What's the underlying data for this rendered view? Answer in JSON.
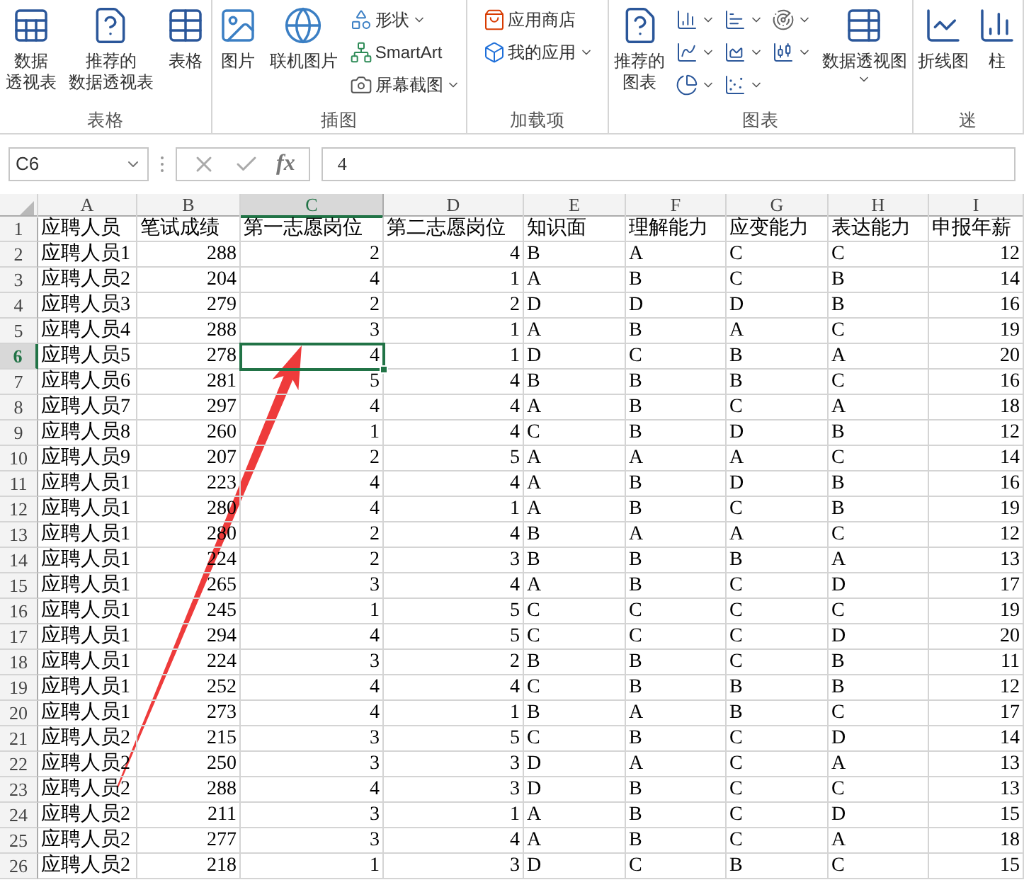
{
  "ribbon": {
    "groups": [
      {
        "label": "表格",
        "items": [
          {
            "kind": "large",
            "lines": [
              "数据",
              "透视表"
            ],
            "dropdown": false
          },
          {
            "kind": "large",
            "lines": [
              "推荐的",
              "数据透视表"
            ],
            "dropdown": false
          },
          {
            "kind": "large",
            "lines": [
              "表格"
            ],
            "dropdown": false
          }
        ]
      },
      {
        "label": "插图",
        "items": [
          {
            "kind": "large",
            "lines": [
              "图片"
            ],
            "dropdown": false
          },
          {
            "kind": "large",
            "lines": [
              "联机图片"
            ],
            "dropdown": false
          },
          {
            "kind": "small",
            "label": "形状",
            "dropdown": true
          },
          {
            "kind": "small",
            "label": "SmartArt",
            "dropdown": false
          },
          {
            "kind": "small",
            "label": "屏幕截图",
            "dropdown": true
          }
        ]
      },
      {
        "label": "加载项",
        "items": [
          {
            "kind": "small",
            "label": "应用商店",
            "dropdown": false
          },
          {
            "kind": "small",
            "label": "我的应用",
            "dropdown": true
          }
        ]
      },
      {
        "label": "图表",
        "items": [
          {
            "kind": "large",
            "lines": [
              "推荐的",
              "图表"
            ],
            "dropdown": false
          },
          {
            "kind": "icon",
            "dropdown": true
          },
          {
            "kind": "icon",
            "dropdown": true
          },
          {
            "kind": "icon",
            "dropdown": true
          },
          {
            "kind": "icon",
            "dropdown": true
          },
          {
            "kind": "icon",
            "dropdown": true
          },
          {
            "kind": "icon",
            "dropdown": true
          },
          {
            "kind": "icon",
            "dropdown": true
          },
          {
            "kind": "icon",
            "dropdown": true
          },
          {
            "kind": "large",
            "lines": [
              "数据透视图"
            ],
            "dropdown": true
          }
        ]
      },
      {
        "label": "迷",
        "items": [
          {
            "kind": "large",
            "lines": [
              "折线图"
            ],
            "dropdown": false
          },
          {
            "kind": "large",
            "lines": [
              "柱"
            ],
            "dropdown": false
          }
        ]
      }
    ]
  },
  "formula_bar": {
    "name_box": "C6",
    "fx_label": "fx",
    "value": "4"
  },
  "sheet": {
    "columns": [
      {
        "label": "A",
        "kind": "text",
        "selected": false
      },
      {
        "label": "B",
        "kind": "number",
        "selected": false
      },
      {
        "label": "C",
        "kind": "number",
        "selected": true
      },
      {
        "label": "D",
        "kind": "number",
        "selected": false
      },
      {
        "label": "E",
        "kind": "text",
        "selected": false
      },
      {
        "label": "F",
        "kind": "text",
        "selected": false
      },
      {
        "label": "G",
        "kind": "text",
        "selected": false
      },
      {
        "label": "H",
        "kind": "text",
        "selected": false
      },
      {
        "label": "I",
        "kind": "number",
        "selected": false
      }
    ],
    "rows": [
      {
        "number": "1",
        "kind": "header",
        "selected": false,
        "cells": [
          "应聘人员",
          "笔试成绩",
          "第一志愿岗位",
          "第二志愿岗位",
          "知识面",
          "理解能力",
          "应变能力",
          "表达能力",
          "申报年薪"
        ]
      },
      {
        "number": "2",
        "kind": "data",
        "selected": false,
        "cells": [
          "应聘人员1",
          "288",
          "2",
          "4",
          "B",
          "A",
          "C",
          "C",
          "12"
        ]
      },
      {
        "number": "3",
        "kind": "data",
        "selected": false,
        "cells": [
          "应聘人员2",
          "204",
          "4",
          "1",
          "A",
          "B",
          "C",
          "B",
          "14"
        ]
      },
      {
        "number": "4",
        "kind": "data",
        "selected": false,
        "cells": [
          "应聘人员3",
          "279",
          "2",
          "2",
          "D",
          "D",
          "D",
          "B",
          "16"
        ]
      },
      {
        "number": "5",
        "kind": "data",
        "selected": false,
        "cells": [
          "应聘人员4",
          "288",
          "3",
          "1",
          "A",
          "B",
          "A",
          "C",
          "19"
        ]
      },
      {
        "number": "6",
        "kind": "data",
        "selected": true,
        "cells": [
          "应聘人员5",
          "278",
          "4",
          "1",
          "D",
          "C",
          "B",
          "A",
          "20"
        ]
      },
      {
        "number": "7",
        "kind": "data",
        "selected": false,
        "cells": [
          "应聘人员6",
          "281",
          "5",
          "4",
          "B",
          "B",
          "B",
          "C",
          "16"
        ]
      },
      {
        "number": "8",
        "kind": "data",
        "selected": false,
        "cells": [
          "应聘人员7",
          "297",
          "4",
          "4",
          "A",
          "B",
          "C",
          "A",
          "18"
        ]
      },
      {
        "number": "9",
        "kind": "data",
        "selected": false,
        "cells": [
          "应聘人员8",
          "260",
          "1",
          "4",
          "C",
          "B",
          "D",
          "B",
          "12"
        ]
      },
      {
        "number": "10",
        "kind": "data",
        "selected": false,
        "cells": [
          "应聘人员9",
          "207",
          "2",
          "5",
          "A",
          "A",
          "A",
          "C",
          "14"
        ]
      },
      {
        "number": "11",
        "kind": "data",
        "selected": false,
        "cells": [
          "应聘人员1",
          "223",
          "4",
          "4",
          "A",
          "B",
          "D",
          "B",
          "16"
        ]
      },
      {
        "number": "12",
        "kind": "data",
        "selected": false,
        "cells": [
          "应聘人员1",
          "280",
          "4",
          "1",
          "A",
          "B",
          "C",
          "B",
          "19"
        ]
      },
      {
        "number": "13",
        "kind": "data",
        "selected": false,
        "cells": [
          "应聘人员1",
          "280",
          "2",
          "4",
          "B",
          "A",
          "A",
          "C",
          "12"
        ]
      },
      {
        "number": "14",
        "kind": "data",
        "selected": false,
        "cells": [
          "应聘人员1",
          "224",
          "2",
          "3",
          "B",
          "B",
          "B",
          "A",
          "13"
        ]
      },
      {
        "number": "15",
        "kind": "data",
        "selected": false,
        "cells": [
          "应聘人员1",
          "265",
          "3",
          "4",
          "A",
          "B",
          "C",
          "D",
          "17"
        ]
      },
      {
        "number": "16",
        "kind": "data",
        "selected": false,
        "cells": [
          "应聘人员1",
          "245",
          "1",
          "5",
          "C",
          "C",
          "C",
          "C",
          "19"
        ]
      },
      {
        "number": "17",
        "kind": "data",
        "selected": false,
        "cells": [
          "应聘人员1",
          "294",
          "4",
          "5",
          "C",
          "C",
          "C",
          "D",
          "20"
        ]
      },
      {
        "number": "18",
        "kind": "data",
        "selected": false,
        "cells": [
          "应聘人员1",
          "224",
          "3",
          "2",
          "B",
          "B",
          "C",
          "B",
          "11"
        ]
      },
      {
        "number": "19",
        "kind": "data",
        "selected": false,
        "cells": [
          "应聘人员1",
          "252",
          "4",
          "4",
          "C",
          "B",
          "B",
          "B",
          "12"
        ]
      },
      {
        "number": "20",
        "kind": "data",
        "selected": false,
        "cells": [
          "应聘人员1",
          "273",
          "4",
          "1",
          "B",
          "A",
          "B",
          "C",
          "17"
        ]
      },
      {
        "number": "21",
        "kind": "data",
        "selected": false,
        "cells": [
          "应聘人员2",
          "215",
          "3",
          "5",
          "C",
          "B",
          "C",
          "D",
          "14"
        ]
      },
      {
        "number": "22",
        "kind": "data",
        "selected": false,
        "cells": [
          "应聘人员2",
          "250",
          "3",
          "3",
          "D",
          "A",
          "C",
          "A",
          "13"
        ]
      },
      {
        "number": "23",
        "kind": "data",
        "selected": false,
        "cells": [
          "应聘人员2",
          "288",
          "4",
          "3",
          "D",
          "B",
          "C",
          "C",
          "13"
        ]
      },
      {
        "number": "24",
        "kind": "data",
        "selected": false,
        "cells": [
          "应聘人员2",
          "211",
          "3",
          "1",
          "A",
          "B",
          "C",
          "D",
          "15"
        ]
      },
      {
        "number": "25",
        "kind": "data",
        "selected": false,
        "cells": [
          "应聘人员2",
          "277",
          "3",
          "4",
          "A",
          "B",
          "C",
          "A",
          "18"
        ]
      },
      {
        "number": "26",
        "kind": "data",
        "selected": false,
        "cells": [
          "应聘人员2",
          "218",
          "1",
          "3",
          "D",
          "C",
          "B",
          "C",
          "15"
        ]
      }
    ]
  }
}
